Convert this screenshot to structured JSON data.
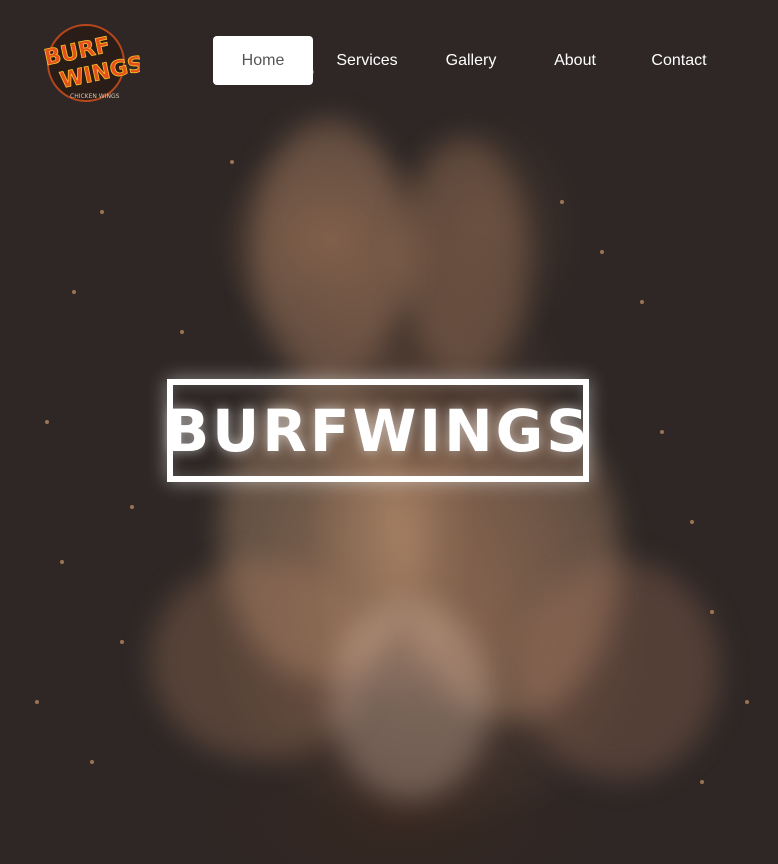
{
  "logo": {
    "main_text_line1": "BURF",
    "main_text_line2": "WINGS",
    "tagline": "CHICKEN WINGS",
    "colors": {
      "fill": "#e8501b",
      "accent": "#f6c12b",
      "ring": "#2a1d17"
    }
  },
  "nav": {
    "items": [
      {
        "label": "Home",
        "active": true
      },
      {
        "label": "Services",
        "active": false
      },
      {
        "label": "Gallery",
        "active": false
      },
      {
        "label": "About",
        "active": false
      },
      {
        "label": "Contact",
        "active": false
      }
    ]
  },
  "hero": {
    "title": "BURFWINGS",
    "background_icon": "fire-embers-image"
  }
}
